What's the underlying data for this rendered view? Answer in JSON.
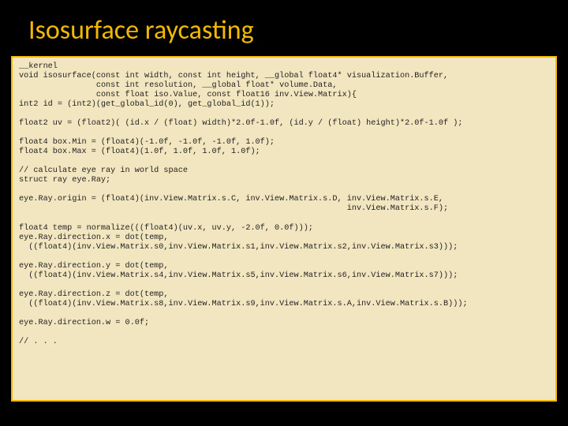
{
  "title": "Isosurface raycasting",
  "code": "__kernel\nvoid isosurface(const int width, const int height, __global float4* visualization.Buffer,\n                const int resolution, __global float* volume.Data,\n                const float iso.Value, const float16 inv.View.Matrix){\nint2 id = (int2)(get_global_id(0), get_global_id(1));\n\nfloat2 uv = (float2)( (id.x / (float) width)*2.0f-1.0f, (id.y / (float) height)*2.0f-1.0f );\n\nfloat4 box.Min = (float4)(-1.0f, -1.0f, -1.0f, 1.0f);\nfloat4 box.Max = (float4)(1.0f, 1.0f, 1.0f, 1.0f);\n\n// calculate eye ray in world space\nstruct ray eye.Ray;\n\neye.Ray.origin = (float4)(inv.View.Matrix.s.C, inv.View.Matrix.s.D, inv.View.Matrix.s.E,\n                                                                    inv.View.Matrix.s.F);\n\nfloat4 temp = normalize(((float4)(uv.x, uv.y, -2.0f, 0.0f)));\neye.Ray.direction.x = dot(temp,\n  ((float4)(inv.View.Matrix.s0,inv.View.Matrix.s1,inv.View.Matrix.s2,inv.View.Matrix.s3)));\n\neye.Ray.direction.y = dot(temp,\n  ((float4)(inv.View.Matrix.s4,inv.View.Matrix.s5,inv.View.Matrix.s6,inv.View.Matrix.s7)));\n\neye.Ray.direction.z = dot(temp,\n  ((float4)(inv.View.Matrix.s8,inv.View.Matrix.s9,inv.View.Matrix.s.A,inv.View.Matrix.s.B)));\n\neye.Ray.direction.w = 0.0f;\n\n// . . ."
}
